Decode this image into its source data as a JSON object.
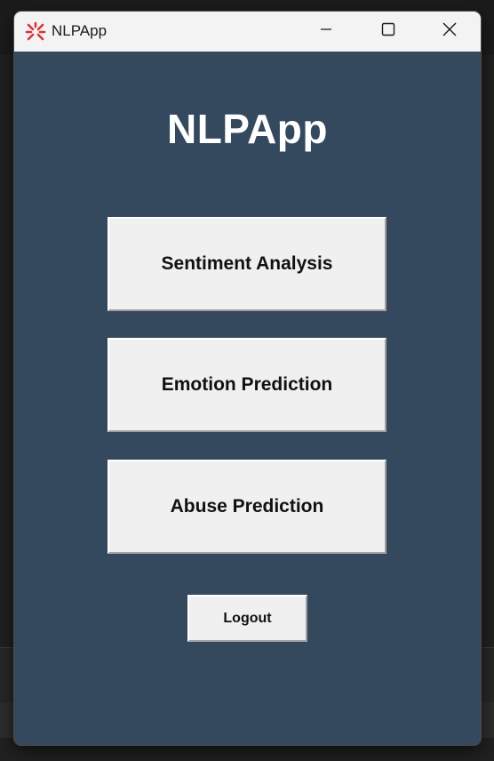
{
  "window": {
    "title": "NLPApp",
    "icon": "red-radial-app-icon",
    "controls": {
      "minimize_icon": "minimize-icon",
      "maximize_icon": "maximize-icon",
      "close_icon": "close-icon"
    }
  },
  "main": {
    "heading": "NLPApp",
    "buttons": [
      {
        "label": "Sentiment Analysis"
      },
      {
        "label": "Emotion Prediction"
      },
      {
        "label": "Abuse Prediction"
      }
    ],
    "logout_label": "Logout"
  },
  "colors": {
    "background": "#34495e",
    "button_face": "#f0f0f0",
    "heading_text": "#ffffff",
    "titlebar": "#f3f3f3",
    "app_icon": "#d9343a"
  }
}
